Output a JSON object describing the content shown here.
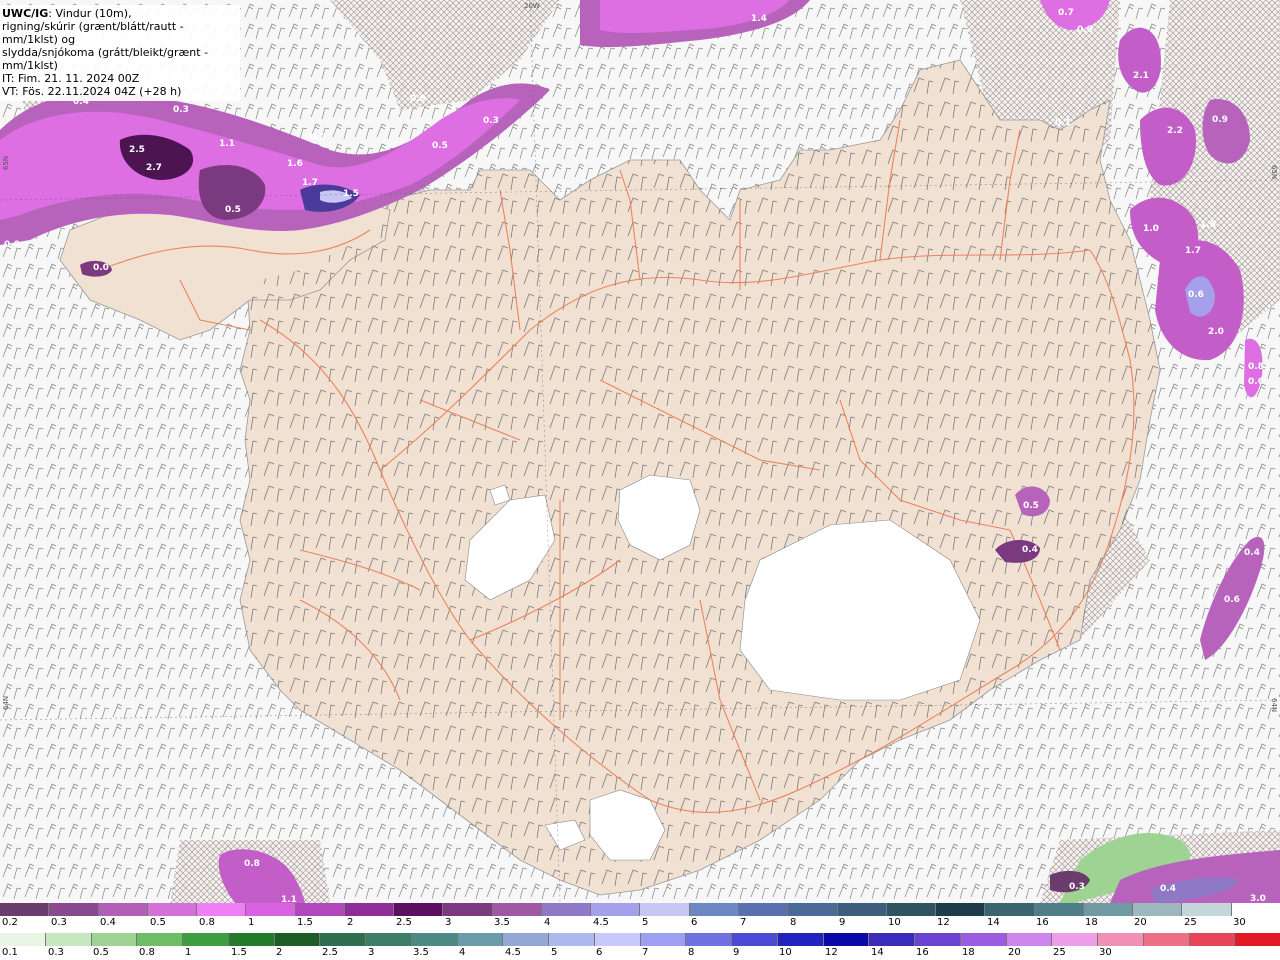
{
  "header": {
    "source": "UWC/IG",
    "desc1": ": Vindur (10m),",
    "desc2": "rigning/skúrir (grænt/blátt/rautt - mm/1klst) og",
    "desc3": "slydda/snjókoma (grátt/bleikt/grænt - mm/1klst)",
    "init_time": "IT: Fim. 21. 11. 2024 00Z",
    "valid_time": "VT: Fös. 22.11.2024 04Z (+28 h)"
  },
  "map": {
    "land_color": "#f1e1d3",
    "road_color": "#ea7a52",
    "edge_labels": {
      "top": "20W",
      "left_top": "65N",
      "left_bottom": "64N",
      "right_top": "65N",
      "right_bottom": "64N"
    },
    "precip_values": [
      "0.4",
      "0.3",
      "2.5",
      "2.7",
      "1.1",
      "0.5",
      "1.6",
      "1.7",
      "1.5",
      "0.2",
      "0.9",
      "0.3",
      "0.5",
      "0.0",
      "0.0",
      "1.4",
      "0.7",
      "0.9",
      "2.1",
      "0.1",
      "2.2",
      "0.9",
      "1.0",
      "1.6",
      "1.7",
      "0.6",
      "2.0",
      "0.8",
      "0.6",
      "0.5",
      "0.4",
      "0.4",
      "0.6",
      "0.8",
      "1.1",
      "0.3",
      "0.4",
      "3.0"
    ]
  },
  "legend": {
    "snow_colors": [
      "#6b3d6f",
      "#8a4a8f",
      "#b060b5",
      "#d371d8",
      "#f07ef5",
      "#d962e0",
      "#b048bb",
      "#8e2e98",
      "#5b0f60",
      "#7b3a80",
      "#9e58a4",
      "#8f78c5",
      "#a4a0ea",
      "#c8c6f4",
      "#6d87c4",
      "#5a6fb0",
      "#4c6a96",
      "#3e5e7e",
      "#2e5362",
      "#1d3b48",
      "#3a6472",
      "#4f7d88",
      "#6f9aa3",
      "#9ab8bd",
      "#c3d6d9",
      "#ffffff"
    ],
    "snow_labels": [
      "0.2",
      "0.3",
      "0.4",
      "0.5",
      "0.8",
      "1",
      "1.5",
      "2",
      "2.5",
      "3",
      "3.5",
      "4",
      "4.5",
      "5",
      "6",
      "7",
      "8",
      "9",
      "10",
      "12",
      "14",
      "16",
      "18",
      "20",
      "25",
      "30"
    ],
    "rain_colors": [
      "#e9f6e5",
      "#c6e8bf",
      "#9ed393",
      "#6cbd63",
      "#3f9e3f",
      "#247a2d",
      "#1c5e25",
      "#2f6e4e",
      "#3d7e68",
      "#4b8b84",
      "#6a9ba8",
      "#93a8d2",
      "#aeb7ee",
      "#c7c8fb",
      "#9e9ef2",
      "#7070e0",
      "#4a4ad2",
      "#2222bf",
      "#0a0aa6",
      "#3a2cb8",
      "#6a44d0",
      "#9a5ce0",
      "#cc86ec",
      "#ee9ee8",
      "#f090b4",
      "#ee6f84",
      "#e64657",
      "#e11a25"
    ],
    "rain_labels": [
      "0.1",
      "0.3",
      "0.5",
      "0.8",
      "1",
      "1.5",
      "2",
      "2.5",
      "3",
      "3.5",
      "4",
      "4.5",
      "5",
      "6",
      "7",
      "8",
      "9",
      "10",
      "12",
      "14",
      "16",
      "18",
      "20",
      "25",
      "30"
    ]
  }
}
